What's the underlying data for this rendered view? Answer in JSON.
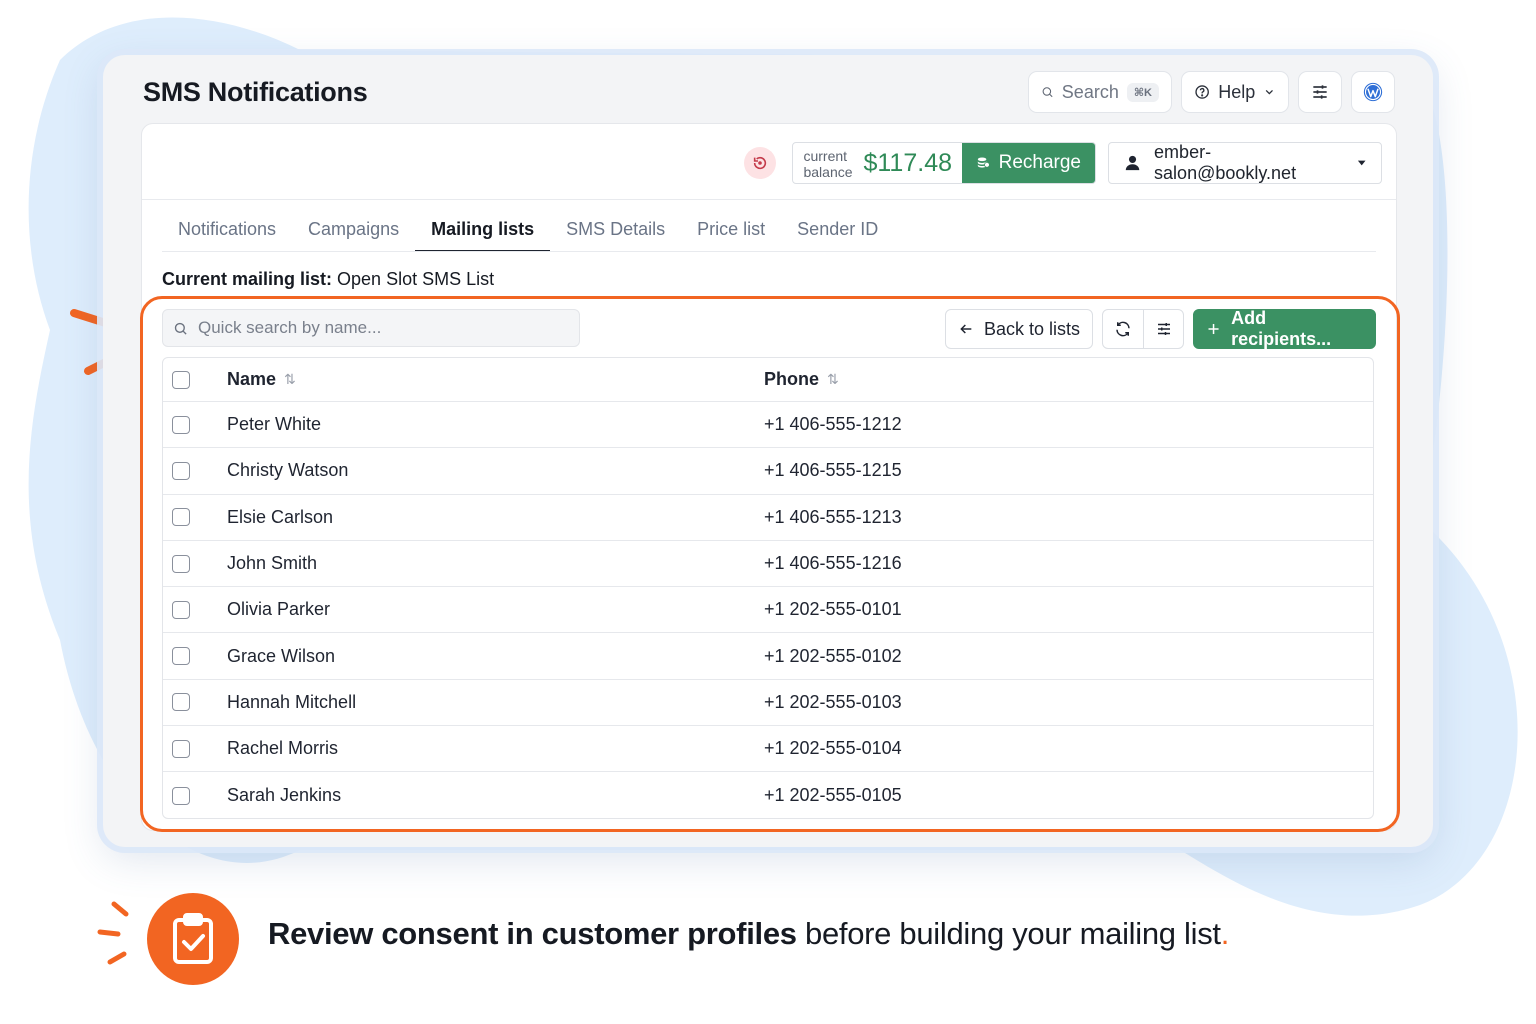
{
  "app": {
    "title": "SMS Notifications"
  },
  "topbar": {
    "search_label": "Search",
    "search_shortcut": "⌘K",
    "help_label": "Help"
  },
  "balance": {
    "label_line1": "current",
    "label_line2": "balance",
    "amount": "$117.48",
    "recharge_label": "Recharge"
  },
  "account": {
    "email": "ember-salon@bookly.net"
  },
  "tabs": [
    {
      "label": "Notifications",
      "active": false
    },
    {
      "label": "Campaigns",
      "active": false
    },
    {
      "label": "Mailing lists",
      "active": true
    },
    {
      "label": "SMS Details",
      "active": false
    },
    {
      "label": "Price list",
      "active": false
    },
    {
      "label": "Sender ID",
      "active": false
    }
  ],
  "mailing_list": {
    "current_label": "Current mailing list:",
    "current_name": "Open Slot SMS List",
    "search_placeholder": "Quick search by name...",
    "back_label": "Back to lists",
    "add_label": "Add recipients..."
  },
  "table": {
    "columns": {
      "name": "Name",
      "phone": "Phone"
    },
    "rows": [
      {
        "name": "Peter White",
        "phone": "+1 406-555-1212"
      },
      {
        "name": "Christy Watson",
        "phone": "+1 406-555-1215"
      },
      {
        "name": "Elsie Carlson",
        "phone": "+1 406-555-1213"
      },
      {
        "name": "John Smith",
        "phone": "+1 406-555-1216"
      },
      {
        "name": "Olivia Parker",
        "phone": "+1 202-555-0101"
      },
      {
        "name": "Grace Wilson",
        "phone": "+1 202-555-0102"
      },
      {
        "name": "Hannah Mitchell",
        "phone": "+1 202-555-0103"
      },
      {
        "name": "Rachel Morris",
        "phone": "+1 202-555-0104"
      },
      {
        "name": "Sarah Jenkins",
        "phone": "+1 202-555-0105"
      }
    ]
  },
  "tip": {
    "bold": "Review consent in customer profiles",
    "rest": " before building your mailing list",
    "period": "."
  },
  "colors": {
    "accent_green": "#3b9163",
    "highlight_orange": "#f26522",
    "background_blob": "#deedfc"
  },
  "icons": [
    "search-icon",
    "help-circle-icon",
    "chevron-down-icon",
    "sliders-icon",
    "wordpress-icon",
    "alert-icon",
    "coins-icon",
    "user-icon",
    "caret-down-icon",
    "arrow-left-icon",
    "refresh-icon",
    "plus-icon",
    "sort-icon",
    "clipboard-check-icon"
  ]
}
